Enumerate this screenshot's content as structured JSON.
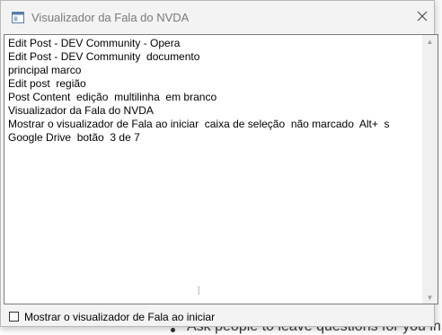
{
  "window": {
    "title": "Visualizador da Fala do NVDA",
    "close_icon": "close-icon",
    "app_icon": "nvda-window-icon"
  },
  "speech_lines": [
    "Edit Post - DEV Community - Opera",
    "Edit Post - DEV Community  documento",
    "principal marco",
    "Edit post  região",
    "Post Content  edição  multilinha  em branco",
    "Visualizador da Fala do NVDA",
    "Mostrar o visualizador de Fala ao iniciar  caixa de seleção  não marcado  Alt+  s",
    "Google Drive  botão  3 de 7"
  ],
  "startup_checkbox": {
    "label": "Mostrar o visualizador de Fala ao iniciar",
    "checked": false
  },
  "background_page": {
    "partial_text": "Ask people to leave questions for you in"
  }
}
